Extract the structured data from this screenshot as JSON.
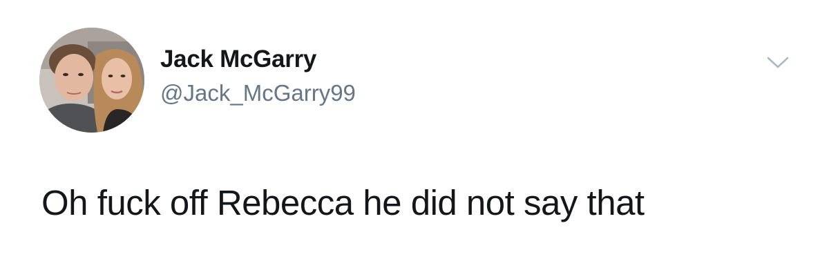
{
  "tweet": {
    "author": {
      "display_name": "Jack McGarry",
      "handle": "@Jack_McGarry99",
      "avatar_icon": "profile-photo"
    },
    "text": "Oh fuck off Rebecca he did not say that",
    "menu_icon": "chevron-down-icon"
  },
  "colors": {
    "text_primary": "#14171a",
    "text_secondary": "#657786",
    "chevron": "#aab8c2",
    "background": "#ffffff"
  }
}
